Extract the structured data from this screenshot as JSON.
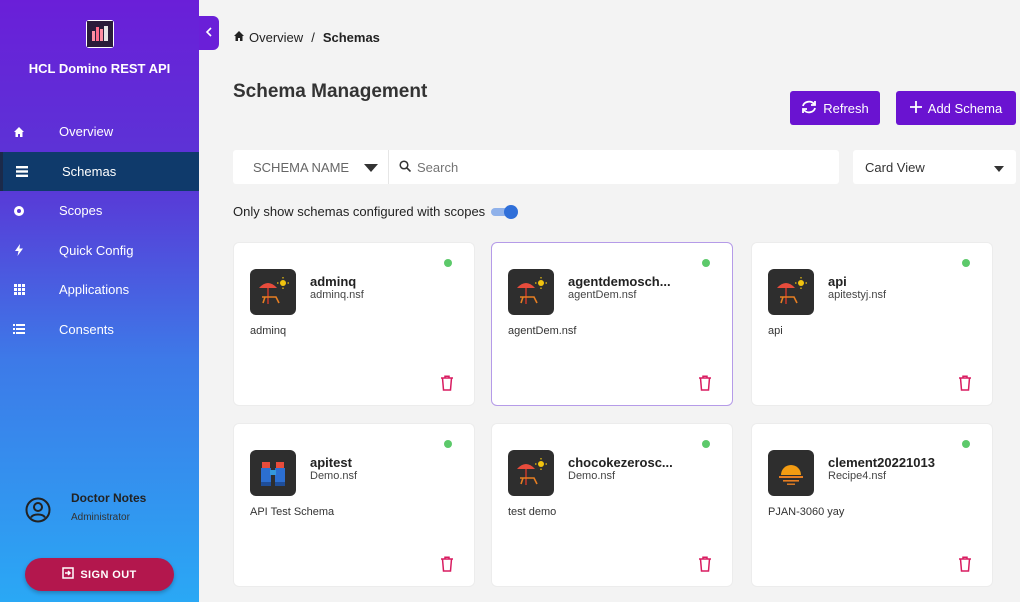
{
  "app": {
    "title": "HCL Domino REST API"
  },
  "sidebar": {
    "items": [
      {
        "label": "Overview",
        "icon": "home-icon"
      },
      {
        "label": "Schemas",
        "icon": "list-icon",
        "active": true
      },
      {
        "label": "Scopes",
        "icon": "target-icon"
      },
      {
        "label": "Quick Config",
        "icon": "bolt-icon"
      },
      {
        "label": "Applications",
        "icon": "grid-icon"
      },
      {
        "label": "Consents",
        "icon": "list-icon"
      }
    ],
    "user": {
      "name": "Doctor Notes",
      "role": "Administrator"
    },
    "signout_label": "SIGN OUT"
  },
  "breadcrumb": {
    "root": "Overview",
    "separator": "/",
    "current": "Schemas"
  },
  "page": {
    "title": "Schema Management"
  },
  "toolbar": {
    "refresh_label": "Refresh",
    "add_label": "Add Schema"
  },
  "filter": {
    "field_label": "SCHEMA NAME",
    "search_placeholder": "Search",
    "view_label": "Card View"
  },
  "scope_toggle": {
    "label": "Only show schemas configured with scopes",
    "on": true
  },
  "cards": [
    {
      "name": "adminq",
      "file": "adminq.nsf",
      "description": "adminq",
      "icon": "beach-icon",
      "status": "active"
    },
    {
      "name": "agentdemosch...",
      "file": "agentDem.nsf",
      "description": "agentDem.nsf",
      "icon": "beach-icon",
      "status": "active",
      "selected": true
    },
    {
      "name": "api",
      "file": "apitestyj.nsf",
      "description": "api",
      "icon": "beach-icon",
      "status": "active"
    },
    {
      "name": "apitest",
      "file": "Demo.nsf",
      "description": "API Test Schema",
      "icon": "binoculars-icon",
      "status": "active"
    },
    {
      "name": "chocokezerosc...",
      "file": "Demo.nsf",
      "description": "test demo",
      "icon": "beach-icon",
      "status": "active"
    },
    {
      "name": "clement20221013",
      "file": "Recipe4.nsf",
      "description": "PJAN-3060 yay",
      "icon": "sunset-icon",
      "status": "active"
    }
  ],
  "colors": {
    "accent": "#6a13d1",
    "signout": "#b3174d",
    "status_active": "#5cc96a",
    "delete": "#d81b60"
  }
}
